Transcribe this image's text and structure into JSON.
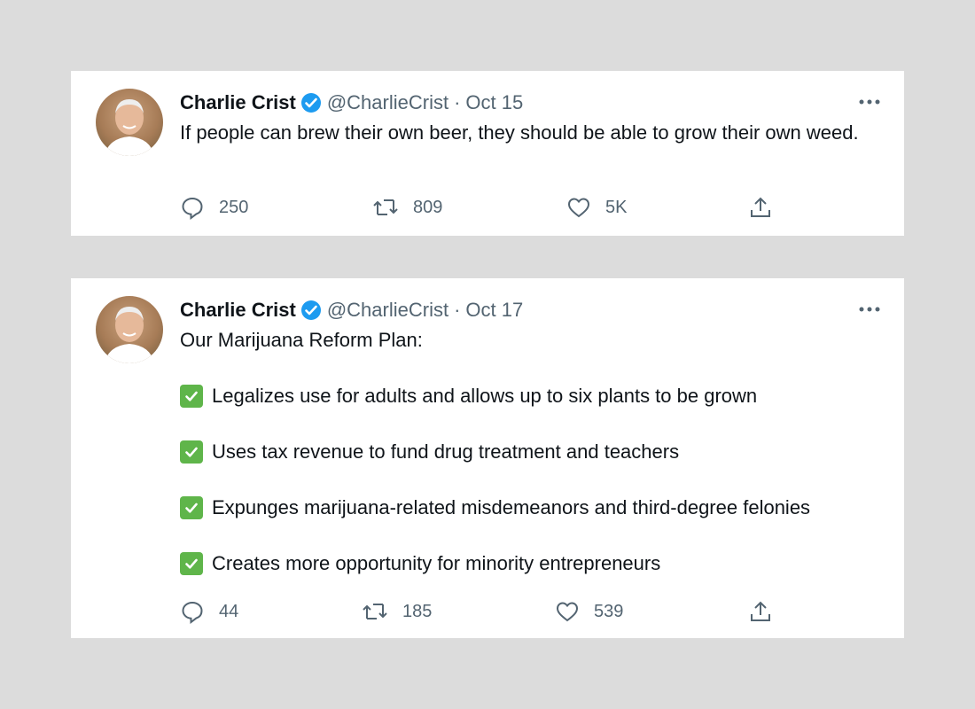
{
  "tweets": [
    {
      "author_name": "Charlie Crist",
      "handle": "@CharlieCrist",
      "separator": "·",
      "date": "Oct 15",
      "text": "If people can brew their own beer, they should be able to grow their own weed.",
      "reply_count": "250",
      "retweet_count": "809",
      "like_count": "5K"
    },
    {
      "author_name": "Charlie Crist",
      "handle": "@CharlieCrist",
      "separator": "·",
      "date": "Oct 17",
      "intro": "Our Marijuana Reform Plan:",
      "items": [
        "Legalizes use for adults and allows up to six plants to be grown",
        "Uses tax revenue to fund drug treatment and teachers",
        "Expunges marijuana-related misdemeanors and third-degree felonies",
        "Creates more opportunity for minority entrepreneurs"
      ],
      "reply_count": "44",
      "retweet_count": "185",
      "like_count": "539"
    }
  ],
  "icons": {
    "verified": "verified-badge-icon",
    "more": "more-options-icon",
    "reply": "reply-icon",
    "retweet": "retweet-icon",
    "like": "like-icon",
    "share": "share-icon",
    "check": "check-mark-icon"
  },
  "colors": {
    "background": "#dcdcdc",
    "card": "#ffffff",
    "verified_blue": "#1d9bf0",
    "check_green": "#5fb54a",
    "secondary_text": "#536471",
    "primary_text": "#0f1419"
  }
}
